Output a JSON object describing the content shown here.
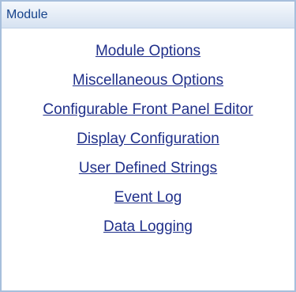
{
  "panel": {
    "title": "Module",
    "links": [
      {
        "label": "Module Options"
      },
      {
        "label": "Miscellaneous Options"
      },
      {
        "label": "Configurable Front Panel Editor"
      },
      {
        "label": "Display Configuration"
      },
      {
        "label": "User Defined Strings"
      },
      {
        "label": "Event Log"
      },
      {
        "label": "Data Logging"
      }
    ]
  },
  "colors": {
    "header_text": "#15428b",
    "link_text": "#1f2f8a",
    "border": "#a7bfdc"
  }
}
